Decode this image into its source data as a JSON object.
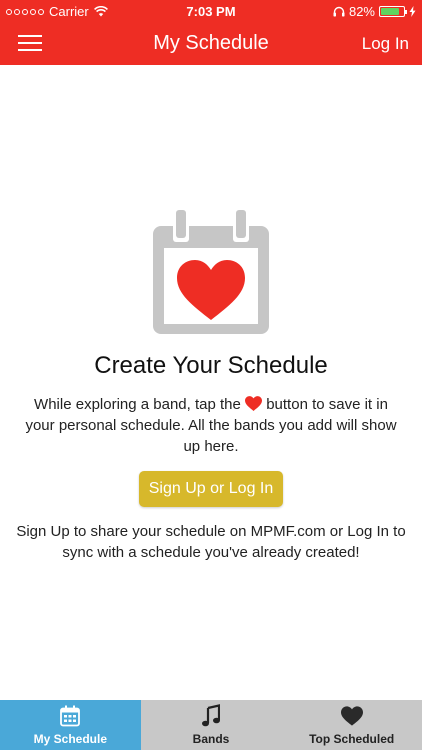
{
  "status_bar": {
    "carrier": "Carrier",
    "time": "7:03 PM",
    "battery": "82%",
    "battery_level": 0.82
  },
  "nav": {
    "title": "My Schedule",
    "login_label": "Log In"
  },
  "main": {
    "headline": "Create Your Schedule",
    "desc_before_heart": "While exploring a band, tap the",
    "desc_after_heart": "button to save it in your personal schedule. All the bands you add will show up here.",
    "signup_label": "Sign Up or Log In",
    "desc2": "Sign Up to share your schedule on MPMF.com or Log In to sync with a schedule you've already created!"
  },
  "tabs": [
    {
      "label": "My Schedule",
      "icon": "calendar-icon",
      "active": true
    },
    {
      "label": "Bands",
      "icon": "music-note-icon",
      "active": false
    },
    {
      "label": "Top Scheduled",
      "icon": "heart-icon",
      "active": false
    }
  ],
  "colors": {
    "header": "#ee2d24",
    "heart": "#ee2d24",
    "button": "#d7b82b",
    "active_tab": "#4aa8d8",
    "tab_bar": "#c8c8c8",
    "calendar": "#c6c6c6"
  }
}
